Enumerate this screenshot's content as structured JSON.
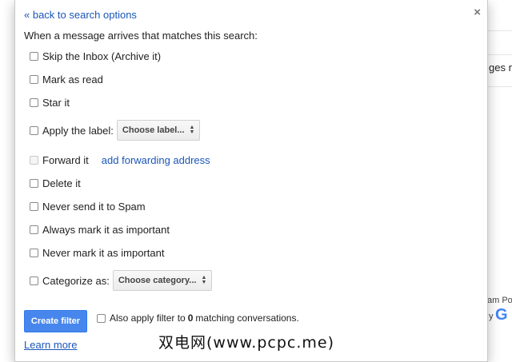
{
  "background": {
    "right_text": "ges m",
    "footer_text": "am Po",
    "footer_text2": "y",
    "google_letter": "G"
  },
  "dialog": {
    "back_link": "« back to search options",
    "close": "×",
    "heading": "When a message arrives that matches this search:",
    "options": {
      "skip_inbox": "Skip the Inbox (Archive it)",
      "mark_read": "Mark as read",
      "star": "Star it",
      "apply_label": "Apply the label:",
      "label_select": "Choose label...",
      "forward": "Forward it",
      "forward_link": "add forwarding address",
      "delete": "Delete it",
      "never_spam": "Never send it to Spam",
      "always_important": "Always mark it as important",
      "never_important": "Never mark it as important",
      "categorize": "Categorize as:",
      "category_select": "Choose category..."
    },
    "create_button": "Create filter",
    "also_apply_prefix": "Also apply filter to",
    "also_apply_count": "0",
    "also_apply_suffix": "matching conversations.",
    "learn_more": "Learn more"
  },
  "watermark": "双电网(www.pcpc.me)"
}
